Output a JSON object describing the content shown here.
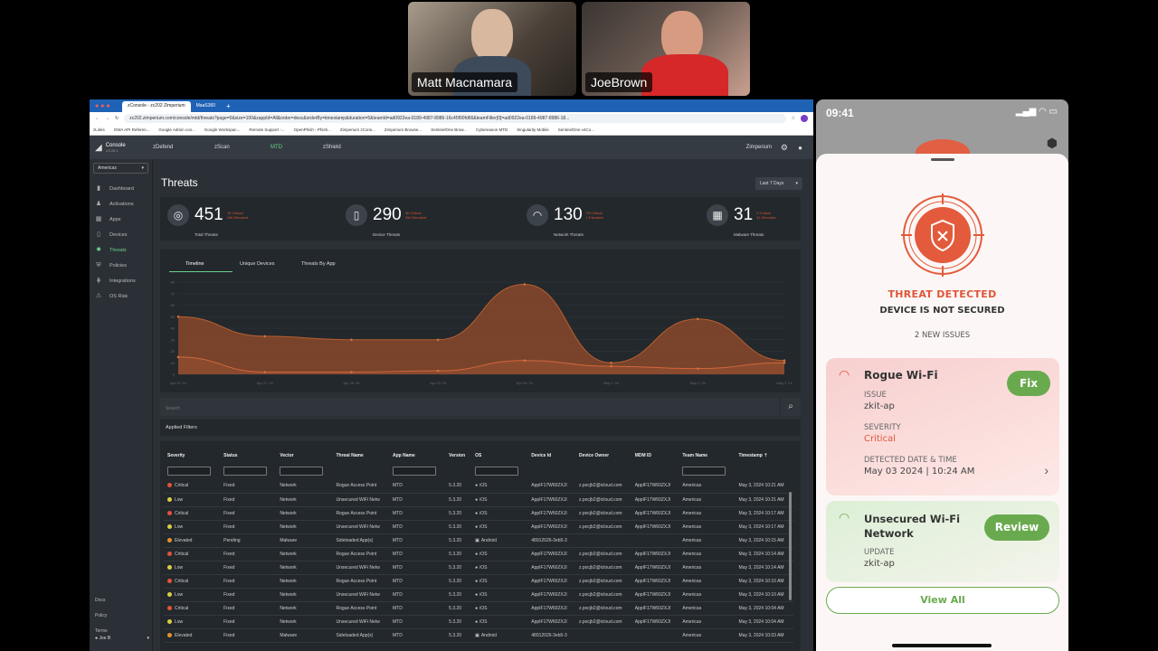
{
  "video": {
    "participants": [
      {
        "name": "Matt Macnamara"
      },
      {
        "name": "JoeBrown"
      }
    ]
  },
  "browser": {
    "tabs": [
      {
        "label": "zConsole - zc202 Zimperium"
      },
      {
        "label": "MaaS360"
      }
    ],
    "url": "zc202.zimperium.com/console/mtd/threats?page=0&size=100&zappId=All&order=desc&orderBy=timestamp&duration=5&teamId=ad0922ea-0189-4987-8986-16c45f90fd66&teamFilter[0]=ad0922ea-0189-4987-8986-18...",
    "bookmarks": [
      "zLinks",
      "GWA API Referen...",
      "Google Admin con...",
      "Google Workspac...",
      "Remote Support -...",
      "OpenPhish - Phish...",
      "Zimperium zCons...",
      "Zimperium Browse...",
      "SentinelOne Brow...",
      "Cybereason MTD",
      "Singularity Mobile",
      "SentinelOne v4Co..."
    ]
  },
  "app": {
    "brand": "Console",
    "version": "v.5.26.1",
    "nav": [
      "zDefend",
      "zScan",
      "MTD",
      "zShield"
    ],
    "active_nav": "MTD",
    "tenant": "Zimperium",
    "region": "Americas",
    "sidebar": [
      {
        "label": "Dashboard",
        "icon": "dashboard-icon"
      },
      {
        "label": "Activations",
        "icon": "activations-icon"
      },
      {
        "label": "Apps",
        "icon": "apps-icon"
      },
      {
        "label": "Devices",
        "icon": "devices-icon"
      },
      {
        "label": "Threats",
        "icon": "threats-icon"
      },
      {
        "label": "Policies",
        "icon": "policies-icon"
      },
      {
        "label": "Integrations",
        "icon": "integrations-icon"
      },
      {
        "label": "OS Risk",
        "icon": "os-risk-icon"
      }
    ],
    "sidebar_footer": [
      "Docs",
      "Policy",
      "Terms"
    ],
    "user": "Joe B",
    "page_title": "Threats",
    "date_range": "Last 7 Days",
    "stats": [
      {
        "value": "451",
        "label": "Total Threats",
        "sub1": "78 Critical",
        "sub2": "186 Elevated"
      },
      {
        "value": "290",
        "label": "Device Threats",
        "sub1": "36 Critical",
        "sub2": "254 Elevated"
      },
      {
        "value": "130",
        "label": "Network Threats",
        "sub1": "75 Critical",
        "sub2": "1 Elevated"
      },
      {
        "value": "31",
        "label": "Malware Threats",
        "sub1": "0 Critical",
        "sub2": "31 Elevated"
      }
    ],
    "chart_tabs": [
      "Timeline",
      "Unique Devices",
      "Threats By App"
    ],
    "search_placeholder": "Search",
    "applied_filters": "Applied Filters",
    "columns": [
      "Severity",
      "Status",
      "Vector",
      "Threat Name",
      "App Name",
      "Version",
      "OS",
      "Device Id",
      "Device Owner",
      "MDM ID",
      "Team Name",
      "Timestamp"
    ],
    "rows": [
      [
        "Critical",
        "Fixed",
        "Network",
        "Rogue Access Point",
        "MTD",
        "5.3.20",
        "iOS",
        "AppIF17W60ZXJI",
        "z.pocjb2@icloud.com",
        "AppIF17W60ZXJI",
        "Americas",
        "May 3, 2024 10:21 AM"
      ],
      [
        "Low",
        "Fixed",
        "Network",
        "Unsecured WiFi Netw",
        "MTD",
        "5.3.20",
        "iOS",
        "AppIF17W60ZXJI",
        "z.pocjb2@icloud.com",
        "AppIF17W60ZXJI",
        "Americas",
        "May 3, 2024 10:21 AM"
      ],
      [
        "Critical",
        "Fixed",
        "Network",
        "Rogue Access Point",
        "MTD",
        "5.3.20",
        "iOS",
        "AppIF17W60ZXJI",
        "z.pocjb2@icloud.com",
        "AppIF17W60ZXJI",
        "Americas",
        "May 3, 2024 10:17 AM"
      ],
      [
        "Low",
        "Fixed",
        "Network",
        "Unsecured WiFi Netw",
        "MTD",
        "5.3.20",
        "iOS",
        "AppIF17W60ZXJI",
        "z.pocjb2@icloud.com",
        "AppIF17W60ZXJI",
        "Americas",
        "May 3, 2024 10:17 AM"
      ],
      [
        "Elevated",
        "Pending",
        "Malware",
        "Sideloaded App(s)",
        "MTD",
        "5.3.20",
        "Android",
        "48912026-3eb5-3",
        "",
        "",
        "Americas",
        "May 3, 2024 10:15 AM"
      ],
      [
        "Critical",
        "Fixed",
        "Network",
        "Rogue Access Point",
        "MTD",
        "5.3.20",
        "iOS",
        "AppIF17W60ZXJI",
        "z.pocjb2@icloud.com",
        "AppIF17W60ZXJI",
        "Americas",
        "May 3, 2024 10:14 AM"
      ],
      [
        "Low",
        "Fixed",
        "Network",
        "Unsecured WiFi Netw",
        "MTD",
        "5.3.20",
        "iOS",
        "AppIF17W60ZXJI",
        "z.pocjb2@icloud.com",
        "AppIF17W60ZXJI",
        "Americas",
        "May 3, 2024 10:14 AM"
      ],
      [
        "Critical",
        "Fixed",
        "Network",
        "Rogue Access Point",
        "MTD",
        "5.3.20",
        "iOS",
        "AppIF17W60ZXJI",
        "z.pocjb2@icloud.com",
        "AppIF17W60ZXJI",
        "Americas",
        "May 3, 2024 10:10 AM"
      ],
      [
        "Low",
        "Fixed",
        "Network",
        "Unsecured WiFi Netw",
        "MTD",
        "5.3.20",
        "iOS",
        "AppIF17W60ZXJI",
        "z.pocjb2@icloud.com",
        "AppIF17W60ZXJI",
        "Americas",
        "May 3, 2024 10:10 AM"
      ],
      [
        "Critical",
        "Fixed",
        "Network",
        "Rogue Access Point",
        "MTD",
        "5.3.20",
        "iOS",
        "AppIF17W60ZXJI",
        "z.pocjb2@icloud.com",
        "AppIF17W60ZXJI",
        "Americas",
        "May 3, 2024 10:04 AM"
      ],
      [
        "Low",
        "Fixed",
        "Network",
        "Unsecured WiFi Netw",
        "MTD",
        "5.3.20",
        "iOS",
        "AppIF17W60ZXJI",
        "z.pocjb2@icloud.com",
        "AppIF17W60ZXJI",
        "Americas",
        "May 3, 2024 10:04 AM"
      ],
      [
        "Elevated",
        "Fixed",
        "Malware",
        "Sideloaded App(s)",
        "MTD",
        "5.3.20",
        "Android",
        "48912026-3eb5-3",
        "",
        "",
        "Americas",
        "May 3, 2024 10:03 AM"
      ]
    ],
    "severity_colors": {
      "Critical": "#e0553a",
      "Low": "#d8cf45",
      "Elevated": "#e8912e"
    }
  },
  "chart_data": {
    "type": "area",
    "categories": [
      "Apr 26 '24",
      "Apr 27 '24",
      "Apr 28 '24",
      "Apr 29 '24",
      "Apr 30 '24",
      "May 1 '24",
      "May 2 '24",
      "May 3 '24"
    ],
    "y_ticks": [
      "0",
      "10",
      "20",
      "30",
      "40",
      "50",
      "60",
      "70",
      "80"
    ],
    "ylim": [
      0,
      80
    ],
    "series": [
      {
        "values": [
          50,
          33,
          30,
          30,
          78,
          10,
          48,
          12
        ],
        "color": "#9c4f2a"
      },
      {
        "values": [
          15,
          2,
          2,
          3,
          12,
          7,
          5,
          10
        ],
        "color": "#c0603a"
      }
    ],
    "grid": true
  },
  "phone": {
    "time": "09:41",
    "status_title": "THREAT DETECTED",
    "status_subtitle": "DEVICE IS NOT SECURED",
    "issue_count": "2 NEW ISSUES",
    "issues": [
      {
        "title": "Rogue Wi-Fi",
        "issue_label": "ISSUE",
        "issue_value": "zkit-ap",
        "severity_label": "SEVERITY",
        "severity_value": "Critical",
        "date_label": "DETECTED DATE & TIME",
        "date_value": "May 03 2024 | 10:24 AM",
        "action": "Fix"
      },
      {
        "title": "Unsecured Wi-Fi Network",
        "update_label": "UPDATE",
        "update_value": "zkit-ap",
        "action": "Review"
      }
    ],
    "view_all": "View All"
  }
}
